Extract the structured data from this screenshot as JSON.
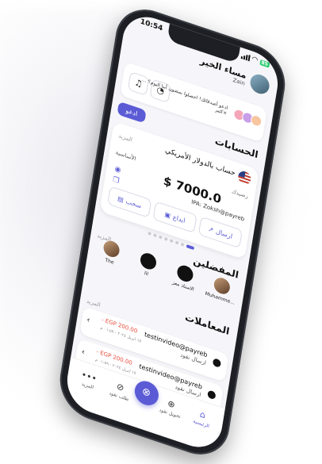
{
  "status": {
    "time": "10:54",
    "battery": "85"
  },
  "header": {
    "greeting": "مساء الخير",
    "user": "Zain"
  },
  "invite": {
    "text": "ادعو أصدقائك! احصلوا بمضون أبنا اليوم؟ ... ×كثير",
    "button": "ادعو"
  },
  "accounts": {
    "title": "الحسابات",
    "account_name": "حساب بالدولار الأمريكي",
    "more": "المزيد",
    "balance_label": "رصيدك",
    "basic_label": "الأساسية",
    "balance": "$ 7000.0",
    "ipa": "IPA: Zoksh@payreb",
    "actions": [
      {
        "label": "ارسال",
        "icon": "send-icon"
      },
      {
        "label": "ايداع",
        "icon": "deposit-icon"
      },
      {
        "label": "سحب",
        "icon": "withdraw-icon"
      }
    ]
  },
  "favorites": {
    "title": "المفضلين",
    "more": "المزيد",
    "items": [
      {
        "name": "Muhamme...",
        "photo": true
      },
      {
        "name": "الاستاذ معز",
        "photo": false
      },
      {
        "name": "lil",
        "photo": false
      },
      {
        "name": "The",
        "photo": true
      }
    ]
  },
  "transactions": {
    "title": "المعاملات",
    "more": "المزيد",
    "items": [
      {
        "who": "testinvideo@payreb",
        "kind": "ارسال نقود",
        "amount": "- EGP 200.00",
        "date": "١٥ ابريل ٢٠٢٤ - ٠١:٥٩ م"
      },
      {
        "who": "testinvideo@payreb",
        "kind": "ارسال نقود",
        "amount": "- EGP 200.00",
        "date": "١٥ ابريل ٢٠٢٤ - ٠١:٥٩ م"
      }
    ]
  },
  "nav": {
    "home": "الرئيسية",
    "transfer": "تحويل نقود",
    "request": "طلب نقود",
    "more": "المزيد"
  },
  "colors": {
    "accent": "#5b5bd6",
    "negative": "#e74c3c"
  }
}
